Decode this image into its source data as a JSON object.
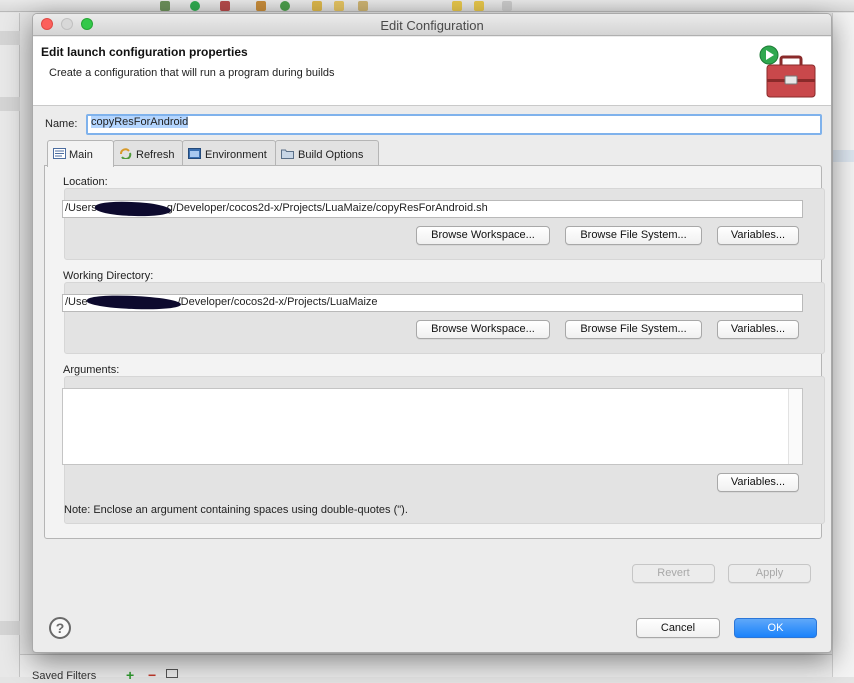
{
  "window": {
    "title": "Edit Configuration"
  },
  "header": {
    "title": "Edit launch configuration properties",
    "subtitle": "Create a configuration that will run a program during builds",
    "icon": "external-tools-toolbox-icon"
  },
  "name_field": {
    "label": "Name:",
    "value": "copyResForAndroid"
  },
  "tabs": [
    {
      "label": "Main",
      "icon": "main-tab-icon",
      "active": true
    },
    {
      "label": "Refresh",
      "icon": "refresh-tab-icon",
      "active": false
    },
    {
      "label": "Environment",
      "icon": "environment-tab-icon",
      "active": false
    },
    {
      "label": "Build Options",
      "icon": "build-options-folder-icon",
      "active": false
    }
  ],
  "location": {
    "label": "Location:",
    "value": "/Users/█████████g/Developer/cocos2d-x/Projects/LuaMaize/copyResForAndroid.sh",
    "prefix": "/Users",
    "suffix": "g/Developer/cocos2d-x/Projects/LuaMaize/copyResForAndroid.sh",
    "buttons": [
      "Browse Workspace...",
      "Browse File System...",
      "Variables..."
    ]
  },
  "working_directory": {
    "label": "Working Directory:",
    "prefix": "/Use",
    "suffix": "/Developer/cocos2d-x/Projects/LuaMaize",
    "buttons": [
      "Browse Workspace...",
      "Browse File System...",
      "Variables..."
    ]
  },
  "arguments": {
    "label": "Arguments:",
    "value": "",
    "variables_button": "Variables...",
    "note": "Note: Enclose an argument containing spaces using double-quotes (\")."
  },
  "panel_buttons": {
    "revert": "Revert",
    "apply": "Apply"
  },
  "dialog_buttons": {
    "cancel": "Cancel",
    "ok": "OK"
  },
  "background": {
    "saved_filters": "Saved Filters"
  },
  "colors": {
    "ok_button": "#1a82fb",
    "selection": "#b4d5fe",
    "focus_ring": "#7fb2ec",
    "close_light": "#fc605c",
    "max_light": "#34c84a"
  }
}
